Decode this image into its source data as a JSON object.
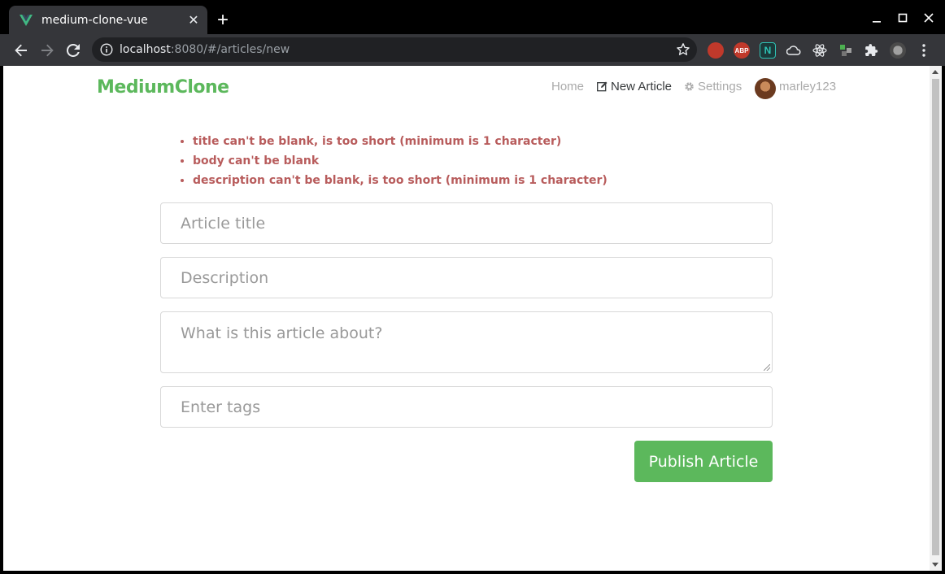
{
  "browser": {
    "tab_title": "medium-clone-vue",
    "url_host": "localhost",
    "url_rest": ":8080/#/articles/new"
  },
  "app": {
    "brand": "MediumClone",
    "nav": {
      "home": "Home",
      "new_article": "New Article",
      "settings": "Settings",
      "username": "marley123"
    },
    "errors": [
      "title can't be blank, is too short (minimum is 1 character)",
      "body can't be blank",
      "description can't be blank, is too short (minimum is 1 character)"
    ],
    "form": {
      "title_placeholder": "Article title",
      "description_placeholder": "Description",
      "body_placeholder": "What is this article about?",
      "tags_placeholder": "Enter tags",
      "submit_label": "Publish Article"
    }
  },
  "colors": {
    "brand_green": "#5cb85c",
    "error_red": "#b85c5c"
  }
}
